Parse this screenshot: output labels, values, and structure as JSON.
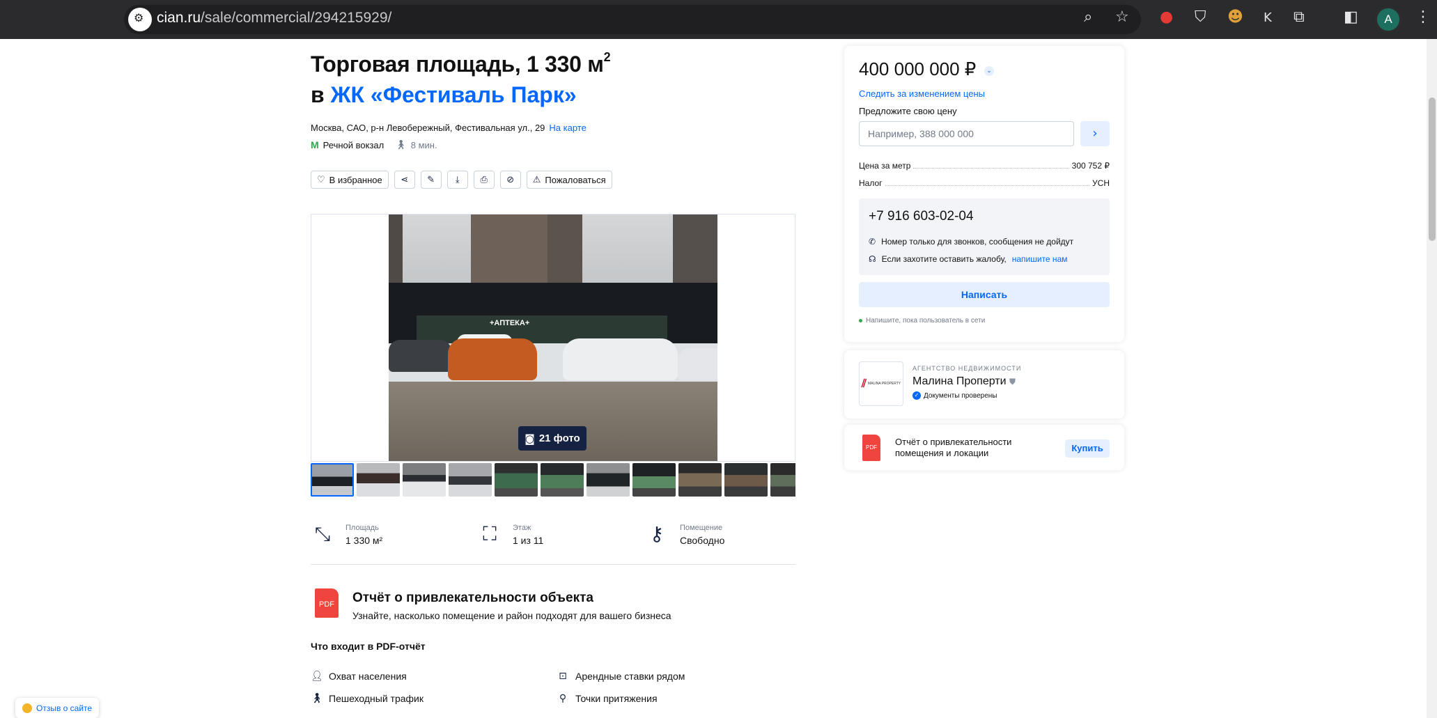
{
  "browser": {
    "url_domain": "cian.ru",
    "url_path": "/sale/commercial/294215929/",
    "profile_initial": "A"
  },
  "listing": {
    "title_line1": "Торговая площадь, 1 330 м",
    "title_sup": "2",
    "title_prefix": "в ",
    "complex_link": "ЖК «Фестиваль Парк»",
    "address": "Москва, САО, р-н Левобережный, Фестивальная ул., 29",
    "map_link": "На карте",
    "metro_station": "Речной вокзал",
    "metro_walk": "8 мин."
  },
  "actions": {
    "favorite": "В избранное",
    "complain": "Пожаловаться"
  },
  "gallery": {
    "photo_count": "21 фото",
    "store_sign_1": "+АПТЕКА+",
    "thumb_count": 11
  },
  "params": [
    {
      "label": "Площадь",
      "value": "1 330 м²",
      "icon": "area-icon"
    },
    {
      "label": "Этаж",
      "value": "1 из 11",
      "icon": "stairs-icon"
    },
    {
      "label": "Помещение",
      "value": "Свободно",
      "icon": "key-icon"
    }
  ],
  "report": {
    "title": "Отчёт о привлекательности объекта",
    "subtitle": "Узнайте, насколько помещение и район подходят для вашего бизнеса",
    "includes_heading": "Что входит в PDF-отчёт",
    "pdf_label": "PDF",
    "features": [
      "Охват населения",
      "Арендные ставки рядом",
      "Пешеходный трафик",
      "Точки притяжения"
    ]
  },
  "feedback": {
    "label": "Отзыв о сайте"
  },
  "price_card": {
    "price": "400 000 000 ₽",
    "follow_link": "Следить за изменением цены",
    "offer_label": "Предложите свою цену",
    "offer_placeholder": "Например, 388 000 000",
    "price_per_meter_label": "Цена за метр",
    "price_per_meter_value": "300 752 ₽",
    "tax_label": "Налог",
    "tax_value": "УСН",
    "phone": "+7 916 603-02-04",
    "note_calls": "Номер только для звонков, сообщения не дойдут",
    "note_complaint": "Если захотите оставить жалобу,",
    "note_complaint_link": "напишите нам",
    "write_button": "Написать",
    "online_note": "Напишите, пока пользователь в сети"
  },
  "agency_card": {
    "type": "АГЕНТСТВО НЕДВИЖИМОСТИ",
    "name": "Малина Проперти",
    "verified": "Документы проверены",
    "logo_text": "MALINA PROPERTY"
  },
  "report_card": {
    "text": "Отчёт о привлекательности помещения и локации",
    "buy_button": "Купить",
    "pdf_label": "PDF"
  },
  "colors": {
    "accent": "#0468ff",
    "accent_light": "#e6efff",
    "pdf_red": "#f0453f",
    "metro_green": "#2da84b"
  }
}
